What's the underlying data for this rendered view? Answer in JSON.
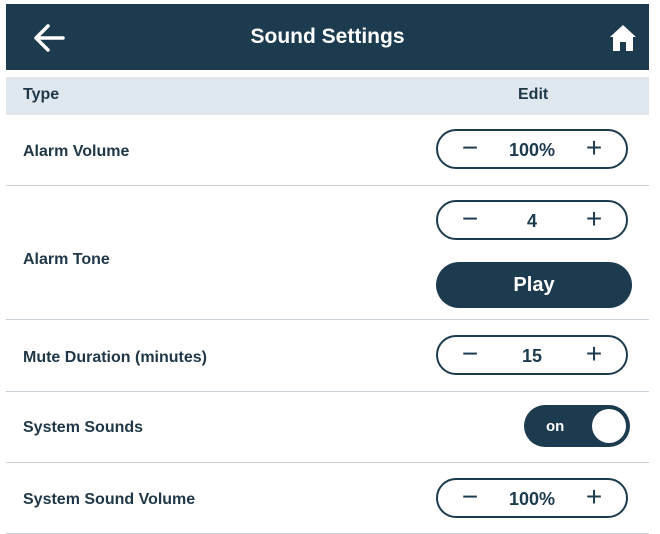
{
  "header": {
    "title": "Sound Settings",
    "back_icon": "arrow-left-icon",
    "home_icon": "home-icon"
  },
  "table": {
    "col_type": "Type",
    "col_edit": "Edit"
  },
  "settings": {
    "alarm_volume": {
      "label": "Alarm Volume",
      "value": "100%"
    },
    "alarm_tone": {
      "label": "Alarm Tone",
      "value": "4",
      "play_label": "Play"
    },
    "mute_duration": {
      "label": "Mute Duration (minutes)",
      "value": "15"
    },
    "system_sounds": {
      "label": "System Sounds",
      "state": "on"
    },
    "system_sound_volume": {
      "label": "System Sound Volume",
      "value": "100%"
    }
  },
  "stepper_symbols": {
    "minus": "−",
    "plus": "+"
  },
  "colors": {
    "primary": "#1d3b4f",
    "header_row_bg": "#dfe7ef",
    "divider": "#c9d1d8"
  }
}
